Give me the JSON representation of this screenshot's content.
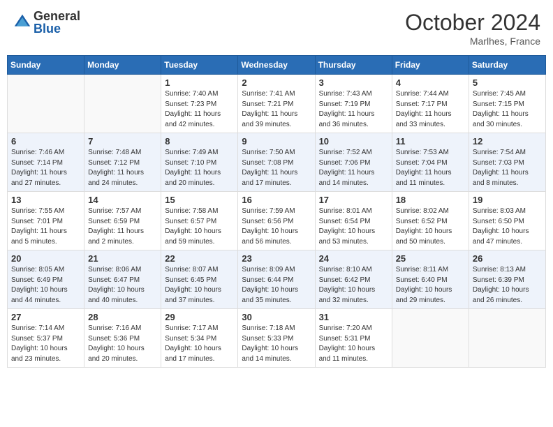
{
  "header": {
    "logo_general": "General",
    "logo_blue": "Blue",
    "month_title": "October 2024",
    "location": "Marlhes, France"
  },
  "days_of_week": [
    "Sunday",
    "Monday",
    "Tuesday",
    "Wednesday",
    "Thursday",
    "Friday",
    "Saturday"
  ],
  "weeks": [
    [
      {
        "day": "",
        "sunrise": "",
        "sunset": "",
        "daylight": ""
      },
      {
        "day": "",
        "sunrise": "",
        "sunset": "",
        "daylight": ""
      },
      {
        "day": "1",
        "sunrise": "Sunrise: 7:40 AM",
        "sunset": "Sunset: 7:23 PM",
        "daylight": "Daylight: 11 hours and 42 minutes."
      },
      {
        "day": "2",
        "sunrise": "Sunrise: 7:41 AM",
        "sunset": "Sunset: 7:21 PM",
        "daylight": "Daylight: 11 hours and 39 minutes."
      },
      {
        "day": "3",
        "sunrise": "Sunrise: 7:43 AM",
        "sunset": "Sunset: 7:19 PM",
        "daylight": "Daylight: 11 hours and 36 minutes."
      },
      {
        "day": "4",
        "sunrise": "Sunrise: 7:44 AM",
        "sunset": "Sunset: 7:17 PM",
        "daylight": "Daylight: 11 hours and 33 minutes."
      },
      {
        "day": "5",
        "sunrise": "Sunrise: 7:45 AM",
        "sunset": "Sunset: 7:15 PM",
        "daylight": "Daylight: 11 hours and 30 minutes."
      }
    ],
    [
      {
        "day": "6",
        "sunrise": "Sunrise: 7:46 AM",
        "sunset": "Sunset: 7:14 PM",
        "daylight": "Daylight: 11 hours and 27 minutes."
      },
      {
        "day": "7",
        "sunrise": "Sunrise: 7:48 AM",
        "sunset": "Sunset: 7:12 PM",
        "daylight": "Daylight: 11 hours and 24 minutes."
      },
      {
        "day": "8",
        "sunrise": "Sunrise: 7:49 AM",
        "sunset": "Sunset: 7:10 PM",
        "daylight": "Daylight: 11 hours and 20 minutes."
      },
      {
        "day": "9",
        "sunrise": "Sunrise: 7:50 AM",
        "sunset": "Sunset: 7:08 PM",
        "daylight": "Daylight: 11 hours and 17 minutes."
      },
      {
        "day": "10",
        "sunrise": "Sunrise: 7:52 AM",
        "sunset": "Sunset: 7:06 PM",
        "daylight": "Daylight: 11 hours and 14 minutes."
      },
      {
        "day": "11",
        "sunrise": "Sunrise: 7:53 AM",
        "sunset": "Sunset: 7:04 PM",
        "daylight": "Daylight: 11 hours and 11 minutes."
      },
      {
        "day": "12",
        "sunrise": "Sunrise: 7:54 AM",
        "sunset": "Sunset: 7:03 PM",
        "daylight": "Daylight: 11 hours and 8 minutes."
      }
    ],
    [
      {
        "day": "13",
        "sunrise": "Sunrise: 7:55 AM",
        "sunset": "Sunset: 7:01 PM",
        "daylight": "Daylight: 11 hours and 5 minutes."
      },
      {
        "day": "14",
        "sunrise": "Sunrise: 7:57 AM",
        "sunset": "Sunset: 6:59 PM",
        "daylight": "Daylight: 11 hours and 2 minutes."
      },
      {
        "day": "15",
        "sunrise": "Sunrise: 7:58 AM",
        "sunset": "Sunset: 6:57 PM",
        "daylight": "Daylight: 10 hours and 59 minutes."
      },
      {
        "day": "16",
        "sunrise": "Sunrise: 7:59 AM",
        "sunset": "Sunset: 6:56 PM",
        "daylight": "Daylight: 10 hours and 56 minutes."
      },
      {
        "day": "17",
        "sunrise": "Sunrise: 8:01 AM",
        "sunset": "Sunset: 6:54 PM",
        "daylight": "Daylight: 10 hours and 53 minutes."
      },
      {
        "day": "18",
        "sunrise": "Sunrise: 8:02 AM",
        "sunset": "Sunset: 6:52 PM",
        "daylight": "Daylight: 10 hours and 50 minutes."
      },
      {
        "day": "19",
        "sunrise": "Sunrise: 8:03 AM",
        "sunset": "Sunset: 6:50 PM",
        "daylight": "Daylight: 10 hours and 47 minutes."
      }
    ],
    [
      {
        "day": "20",
        "sunrise": "Sunrise: 8:05 AM",
        "sunset": "Sunset: 6:49 PM",
        "daylight": "Daylight: 10 hours and 44 minutes."
      },
      {
        "day": "21",
        "sunrise": "Sunrise: 8:06 AM",
        "sunset": "Sunset: 6:47 PM",
        "daylight": "Daylight: 10 hours and 40 minutes."
      },
      {
        "day": "22",
        "sunrise": "Sunrise: 8:07 AM",
        "sunset": "Sunset: 6:45 PM",
        "daylight": "Daylight: 10 hours and 37 minutes."
      },
      {
        "day": "23",
        "sunrise": "Sunrise: 8:09 AM",
        "sunset": "Sunset: 6:44 PM",
        "daylight": "Daylight: 10 hours and 35 minutes."
      },
      {
        "day": "24",
        "sunrise": "Sunrise: 8:10 AM",
        "sunset": "Sunset: 6:42 PM",
        "daylight": "Daylight: 10 hours and 32 minutes."
      },
      {
        "day": "25",
        "sunrise": "Sunrise: 8:11 AM",
        "sunset": "Sunset: 6:40 PM",
        "daylight": "Daylight: 10 hours and 29 minutes."
      },
      {
        "day": "26",
        "sunrise": "Sunrise: 8:13 AM",
        "sunset": "Sunset: 6:39 PM",
        "daylight": "Daylight: 10 hours and 26 minutes."
      }
    ],
    [
      {
        "day": "27",
        "sunrise": "Sunrise: 7:14 AM",
        "sunset": "Sunset: 5:37 PM",
        "daylight": "Daylight: 10 hours and 23 minutes."
      },
      {
        "day": "28",
        "sunrise": "Sunrise: 7:16 AM",
        "sunset": "Sunset: 5:36 PM",
        "daylight": "Daylight: 10 hours and 20 minutes."
      },
      {
        "day": "29",
        "sunrise": "Sunrise: 7:17 AM",
        "sunset": "Sunset: 5:34 PM",
        "daylight": "Daylight: 10 hours and 17 minutes."
      },
      {
        "day": "30",
        "sunrise": "Sunrise: 7:18 AM",
        "sunset": "Sunset: 5:33 PM",
        "daylight": "Daylight: 10 hours and 14 minutes."
      },
      {
        "day": "31",
        "sunrise": "Sunrise: 7:20 AM",
        "sunset": "Sunset: 5:31 PM",
        "daylight": "Daylight: 10 hours and 11 minutes."
      },
      {
        "day": "",
        "sunrise": "",
        "sunset": "",
        "daylight": ""
      },
      {
        "day": "",
        "sunrise": "",
        "sunset": "",
        "daylight": ""
      }
    ]
  ]
}
